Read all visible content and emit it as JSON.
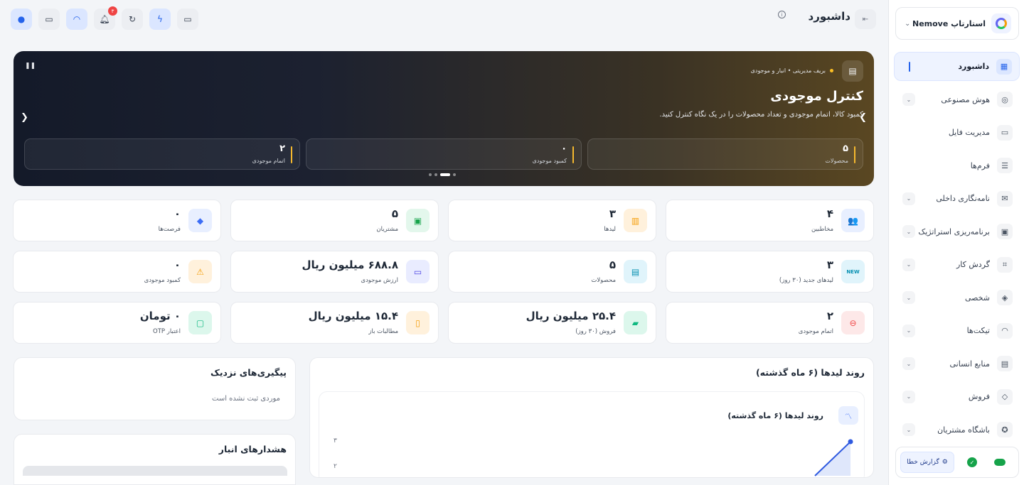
{
  "org": {
    "name": "استارتاپ Nemove"
  },
  "nav": [
    {
      "label": "داشبورد",
      "icon": "grid-icon",
      "glyph": "▦",
      "active": true,
      "expandable": false
    },
    {
      "label": "هوش مصنوعی",
      "icon": "brain-icon",
      "glyph": "◎",
      "active": false,
      "expandable": true
    },
    {
      "label": "مدیریت فایل",
      "icon": "folder-icon",
      "glyph": "▭",
      "active": false,
      "expandable": false
    },
    {
      "label": "فرم‌ها",
      "icon": "form-icon",
      "glyph": "☰",
      "active": false,
      "expandable": false
    },
    {
      "label": "نامه‌نگاری داخلی",
      "icon": "mail-icon",
      "glyph": "✉",
      "active": false,
      "expandable": true
    },
    {
      "label": "برنامه‌ریزی استراتژیک",
      "icon": "briefcase-icon",
      "glyph": "▣",
      "active": false,
      "expandable": true
    },
    {
      "label": "گردش کار",
      "icon": "workflow-icon",
      "glyph": "⌗",
      "active": false,
      "expandable": true
    },
    {
      "label": "شخصی",
      "icon": "shield-user-icon",
      "glyph": "◈",
      "active": false,
      "expandable": true
    },
    {
      "label": "تیکت‌ها",
      "icon": "headset-icon",
      "glyph": "◠",
      "active": false,
      "expandable": true
    },
    {
      "label": "منابع انسانی",
      "icon": "id-card-icon",
      "glyph": "▤",
      "active": false,
      "expandable": true
    },
    {
      "label": "فروش",
      "icon": "tag-icon",
      "glyph": "◇",
      "active": false,
      "expandable": true
    },
    {
      "label": "باشگاه مشتریان",
      "icon": "award-icon",
      "glyph": "✪",
      "active": false,
      "expandable": true
    }
  ],
  "footer": {
    "report_label": "گزارش خطا"
  },
  "topbar": {
    "title": "داشبورد",
    "notification_count": "۳"
  },
  "hero": {
    "breadcrumb": "بریف مدیریتی • انبار و موجودی",
    "title": "کنترل موجودی",
    "subtitle": "کمبود کالا، اتمام موجودی و تعداد محصولات را در یک نگاه کنترل کنید.",
    "stats": [
      {
        "value": "۵",
        "label": "محصولات"
      },
      {
        "value": "۰",
        "label": "کمبود موجودی"
      },
      {
        "value": "۲",
        "label": "اتمام موجودی"
      }
    ],
    "slides": 4,
    "active_slide": 2
  },
  "kpis": [
    {
      "value": "۴",
      "label": "مخاطبین",
      "icon": "users-icon",
      "glyph": "👥",
      "color": "c-blue"
    },
    {
      "value": "۳",
      "label": "لیدها",
      "icon": "bar-chart-icon",
      "glyph": "▥",
      "color": "c-orange"
    },
    {
      "value": "۵",
      "label": "مشتریان",
      "icon": "store-icon",
      "glyph": "▣",
      "color": "c-green"
    },
    {
      "value": "۰",
      "label": "فرصت‌ها",
      "icon": "diamond-icon",
      "glyph": "◆",
      "color": "c-blue"
    },
    {
      "value": "۳",
      "label": "لیدهای جدید (۳۰ روز)",
      "icon": "new-badge-icon",
      "glyph": "NEW",
      "color": "c-cyan"
    },
    {
      "value": "۵",
      "label": "محصولات",
      "icon": "archive-icon",
      "glyph": "▤",
      "color": "c-cyan"
    },
    {
      "value": "۶۸۸.۸ میلیون ریال",
      "label": "ارزش موجودی",
      "icon": "wallet-icon",
      "glyph": "▭",
      "color": "c-violet"
    },
    {
      "value": "۰",
      "label": "کمبود موجودی",
      "icon": "warning-icon",
      "glyph": "⚠",
      "color": "c-orange"
    },
    {
      "value": "۲",
      "label": "اتمام موجودی",
      "icon": "minus-circle-icon",
      "glyph": "⊖",
      "color": "c-red"
    },
    {
      "value": "۲۵.۴ میلیون ریال",
      "label": "فروش (۳۰ روز)",
      "icon": "cash-register-icon",
      "glyph": "▰",
      "color": "c-teal"
    },
    {
      "value": "۱۵.۴ میلیون ریال",
      "label": "مطالبات باز",
      "icon": "receipt-icon",
      "glyph": "▯",
      "color": "c-orange"
    },
    {
      "value": "۰ تومان",
      "label": "اعتبار OTP",
      "icon": "message-icon",
      "glyph": "▢",
      "color": "c-teal"
    }
  ],
  "leads_panel": {
    "title": "روند لیدها (۶ ماه گذشته)",
    "chart_title": "روند لیدها (۶ ماه گذشته)",
    "y_ticks": [
      "۳",
      "۲"
    ]
  },
  "followups": {
    "title": "پیگیری‌های نزدیک",
    "empty": "موردی ثبت نشده است"
  },
  "alerts": {
    "title": "هشدارهای انبار"
  },
  "chart_data": {
    "type": "area",
    "title": "روند لیدها (۶ ماه گذشته)",
    "visible_y_ticks": [
      3,
      2
    ],
    "note_values": [
      {
        "y": 3
      }
    ]
  }
}
